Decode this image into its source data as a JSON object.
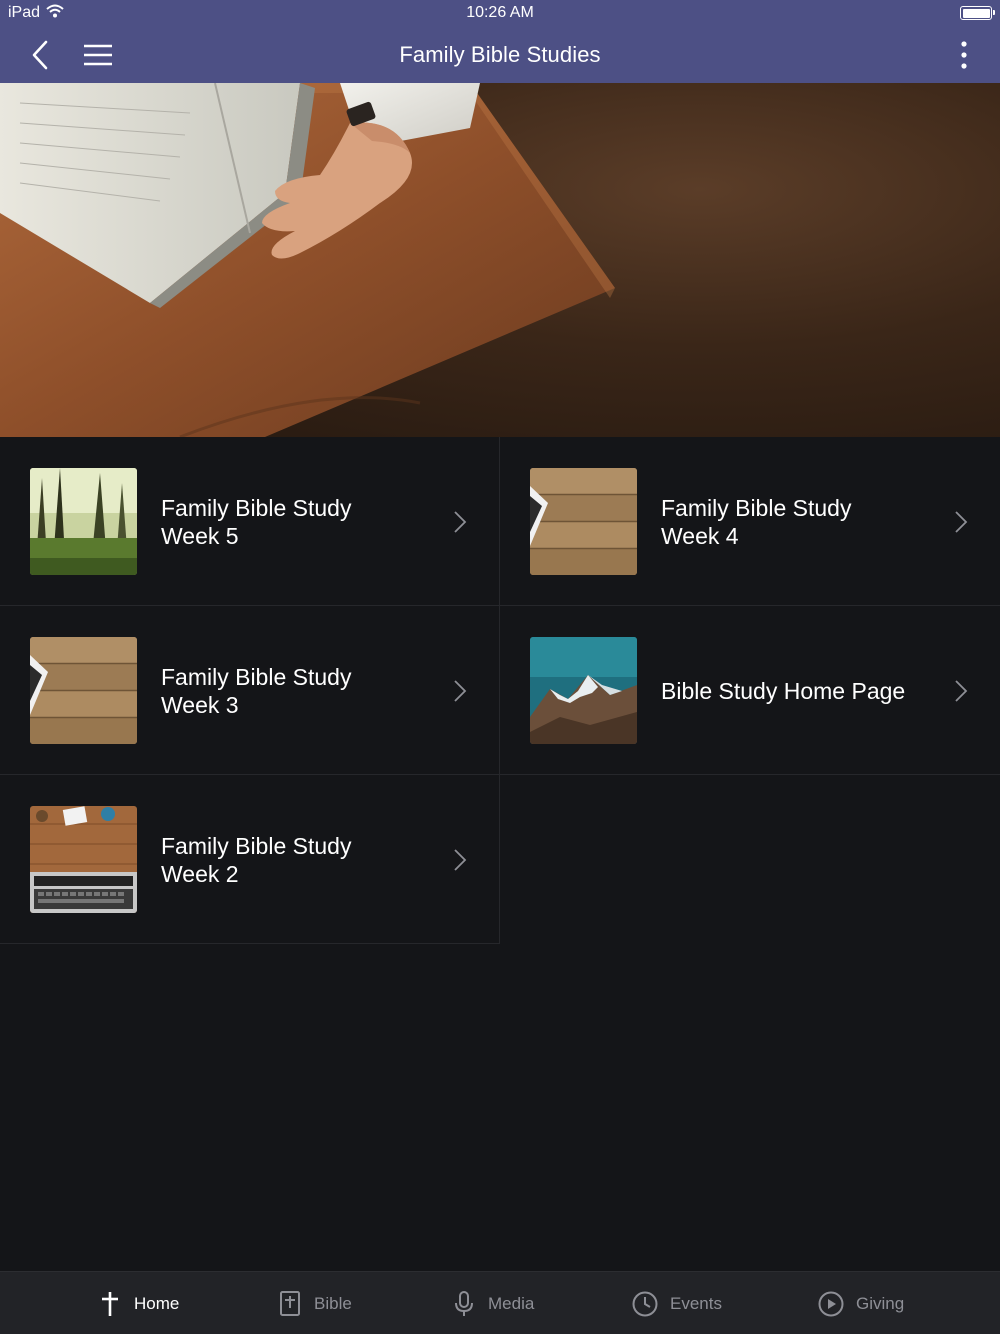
{
  "status_bar": {
    "device": "iPad",
    "time": "10:26 AM"
  },
  "nav": {
    "title": "Family Bible Studies",
    "back_icon": "chevron-left-icon",
    "menu_icon": "hamburger-icon",
    "more_icon": "vertical-ellipsis-icon"
  },
  "hero": {
    "image": "hand-over-open-bible-on-wooden-pulpit"
  },
  "items": [
    {
      "line1": "Family Bible Study",
      "line2": "Week 5",
      "thumb": "forest"
    },
    {
      "line1": "Family Bible Study",
      "line2": "Week 4",
      "thumb": "wood-planks"
    },
    {
      "line1": "Family Bible Study",
      "line2": "Week 3",
      "thumb": "wood-planks"
    },
    {
      "line1": "Bible Study Home Page",
      "line2": "",
      "thumb": "mountains"
    },
    {
      "line1": "Family Bible Study",
      "line2": "Week 2",
      "thumb": "desk-laptop"
    }
  ],
  "tabbar": {
    "tabs": [
      {
        "label": "Home",
        "icon": "cross-icon",
        "active": true
      },
      {
        "label": "Bible",
        "icon": "bible-icon",
        "active": false
      },
      {
        "label": "Media",
        "icon": "microphone-icon",
        "active": false
      },
      {
        "label": "Events",
        "icon": "clock-icon",
        "active": false
      },
      {
        "label": "Giving",
        "icon": "play-circle-icon",
        "active": false
      }
    ]
  },
  "colors": {
    "nav_bg": "#4d5085",
    "page_bg": "#141518",
    "tabbar_bg": "#222327",
    "tab_inactive": "#8e8f96",
    "tab_active": "#ffffff"
  }
}
